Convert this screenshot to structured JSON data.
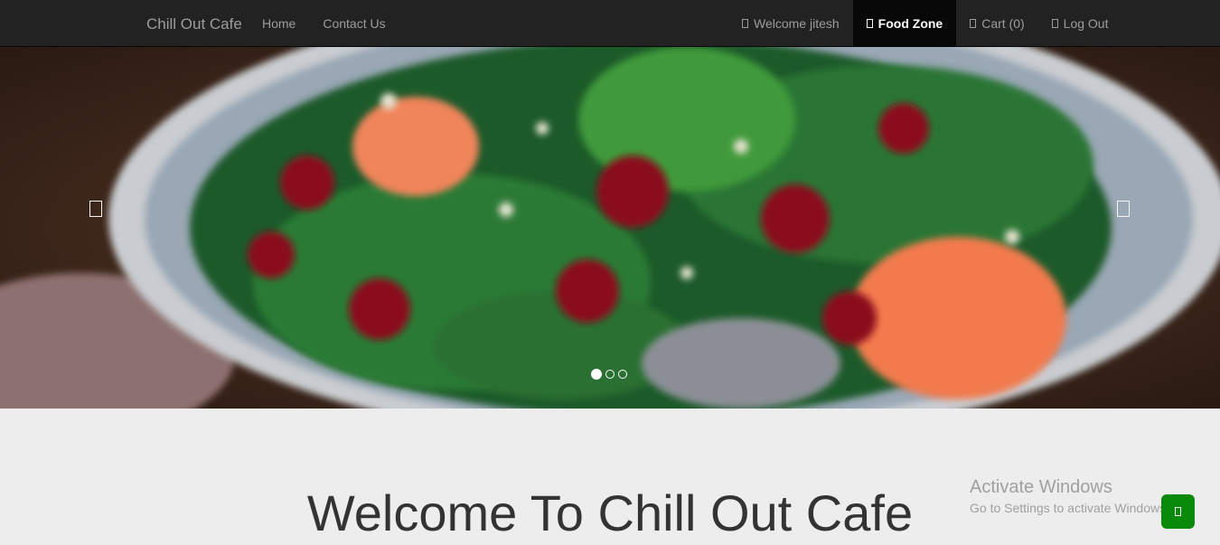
{
  "navbar": {
    "brand": "Chill Out Cafe",
    "left_links": [
      {
        "label": "Home"
      },
      {
        "label": "Contact Us"
      }
    ],
    "right_links": [
      {
        "label": "Welcome jitesh",
        "icon": "user-icon"
      },
      {
        "label": "Food Zone",
        "icon": "cutlery-icon",
        "active": true
      },
      {
        "label": "Cart (0)",
        "icon": "cart-icon"
      },
      {
        "label": "Log Out",
        "icon": "logout-icon"
      }
    ]
  },
  "carousel": {
    "slide_count": 3,
    "active_index": 0,
    "prev_icon": "chevron-left-icon",
    "next_icon": "chevron-right-icon"
  },
  "main": {
    "heading": "Welcome To Chill Out Cafe"
  },
  "watermark": {
    "title": "Activate Windows",
    "subtitle": "Go to Settings to activate Windows."
  },
  "floating_button": {
    "icon": "chat-icon",
    "color": "#0a8a0a"
  },
  "colors": {
    "navbar_bg": "#222222",
    "nav_text": "#9d9d9d",
    "active_bg": "#080808",
    "page_bg": "#ededed"
  }
}
